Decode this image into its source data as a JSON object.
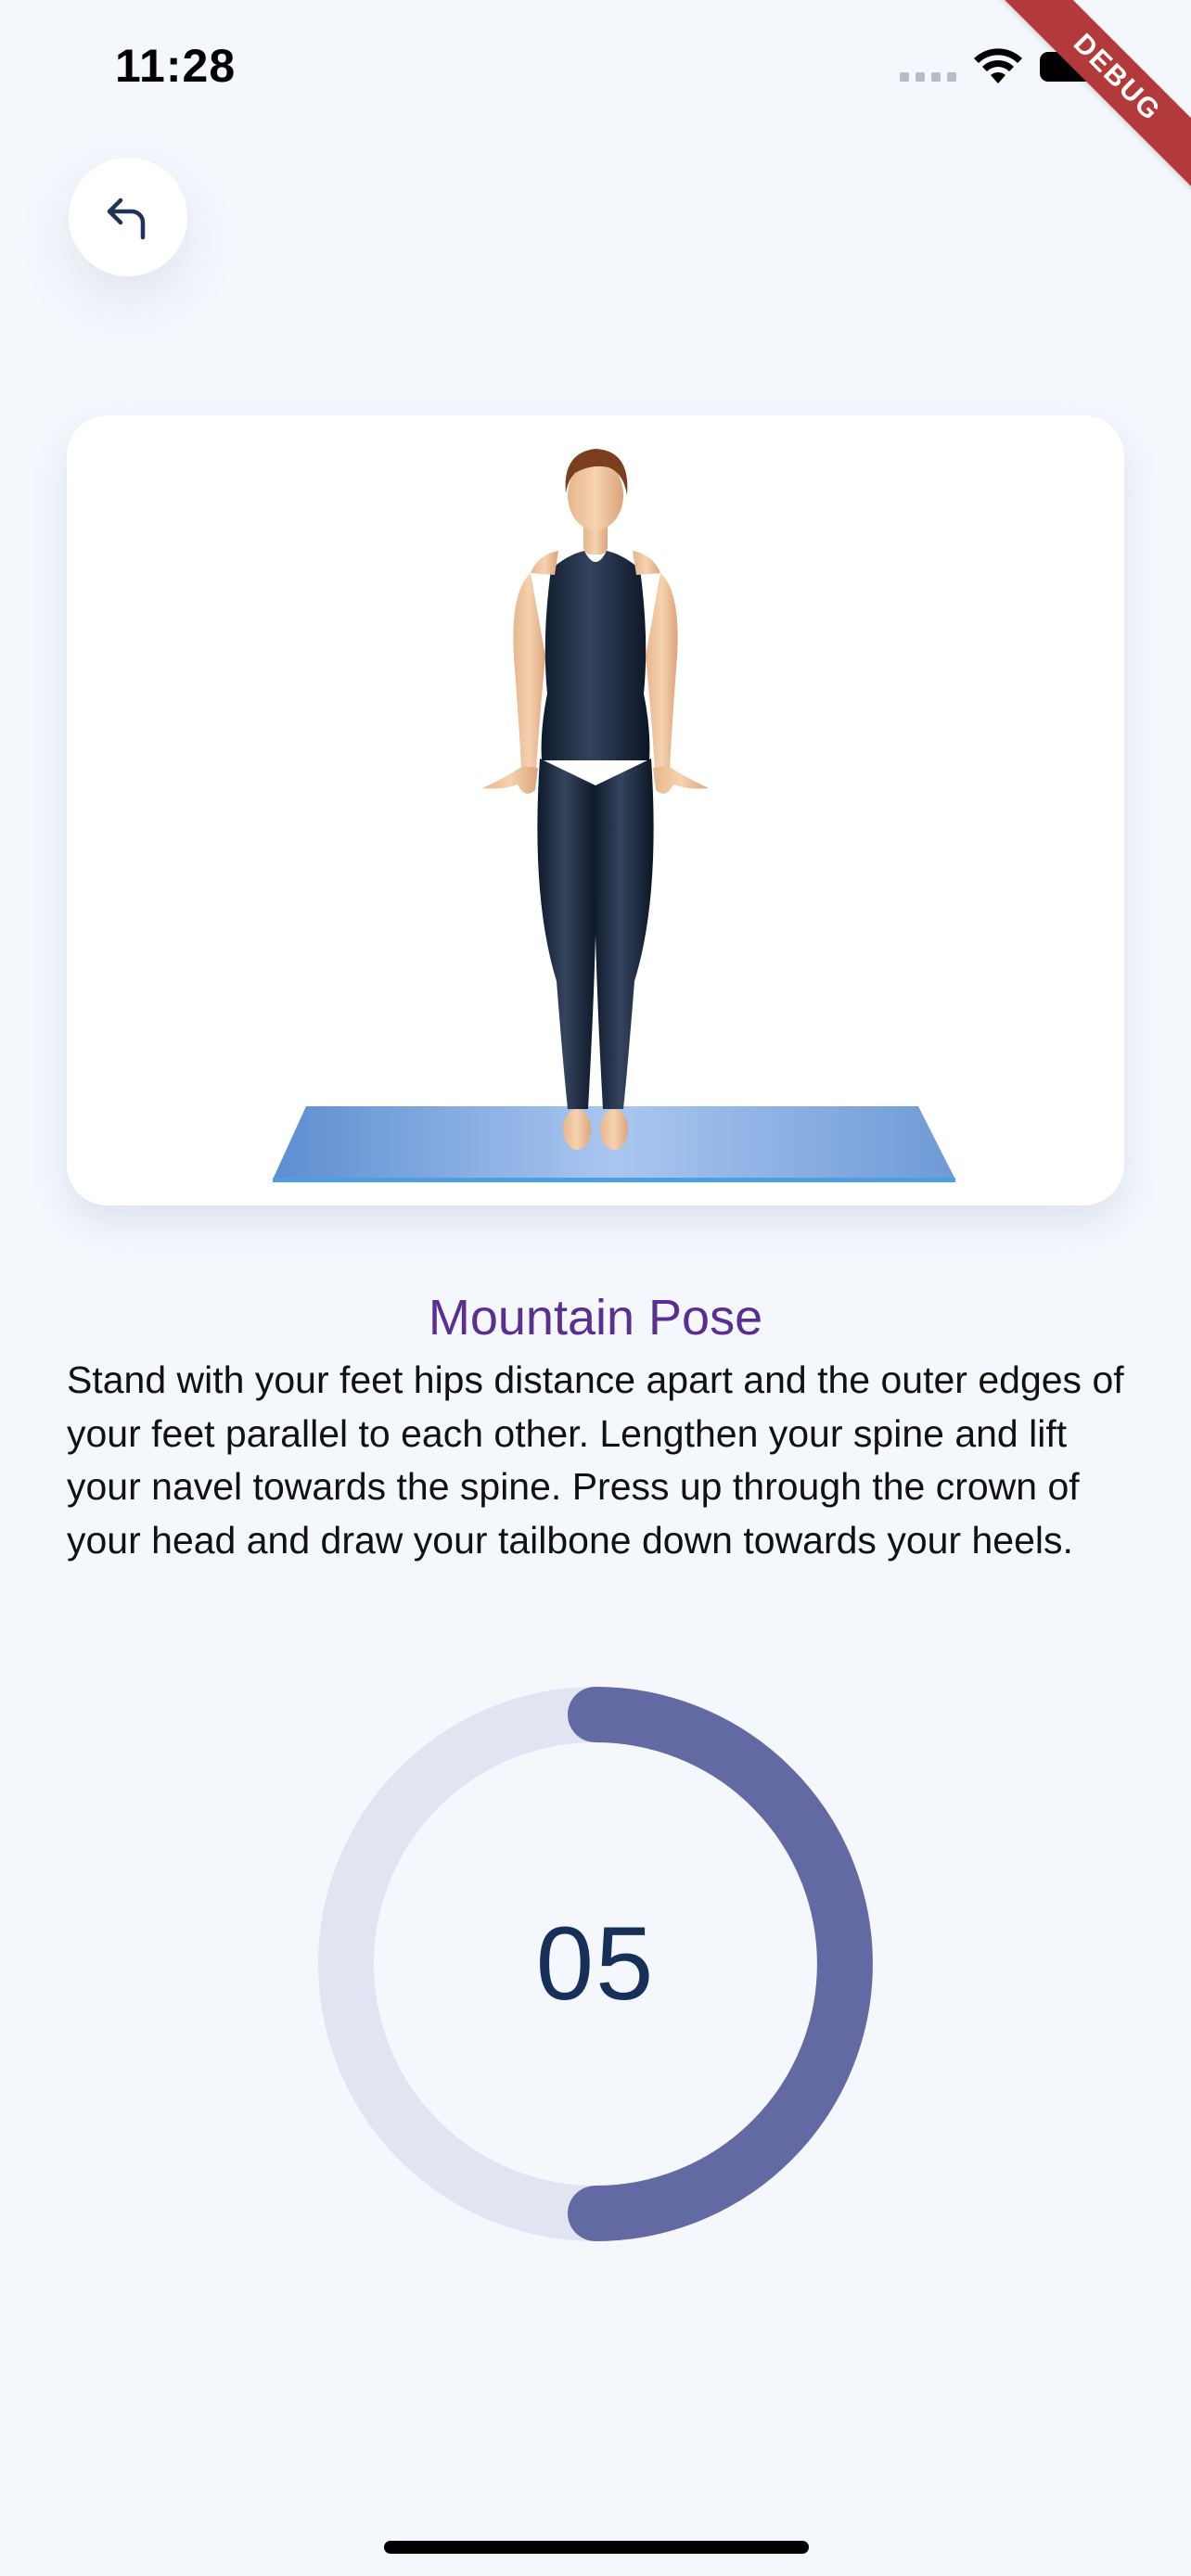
{
  "status_bar": {
    "time": "11:28",
    "debug_label": "DEBUG"
  },
  "header": {
    "back_icon": "back-arrow-icon"
  },
  "pose": {
    "image_icon": "mountain-pose-figure-illustration",
    "title": "Mountain Pose",
    "description": "Stand with your feet hips distance apart and the outer edges of your feet parallel to each other. Lengthen your spine and lift your navel towards the spine. Press up through the crown of your head and draw your tailbone down towards your heels."
  },
  "timer": {
    "count": "05",
    "progress_fraction": 0.5,
    "colors": {
      "track": "#e1e5f1",
      "progress": "#636aa3",
      "text": "#17305a"
    }
  },
  "colors": {
    "background": "#f4f8fd",
    "title": "#5b2e91",
    "debug_ribbon": "#b23a3a"
  }
}
